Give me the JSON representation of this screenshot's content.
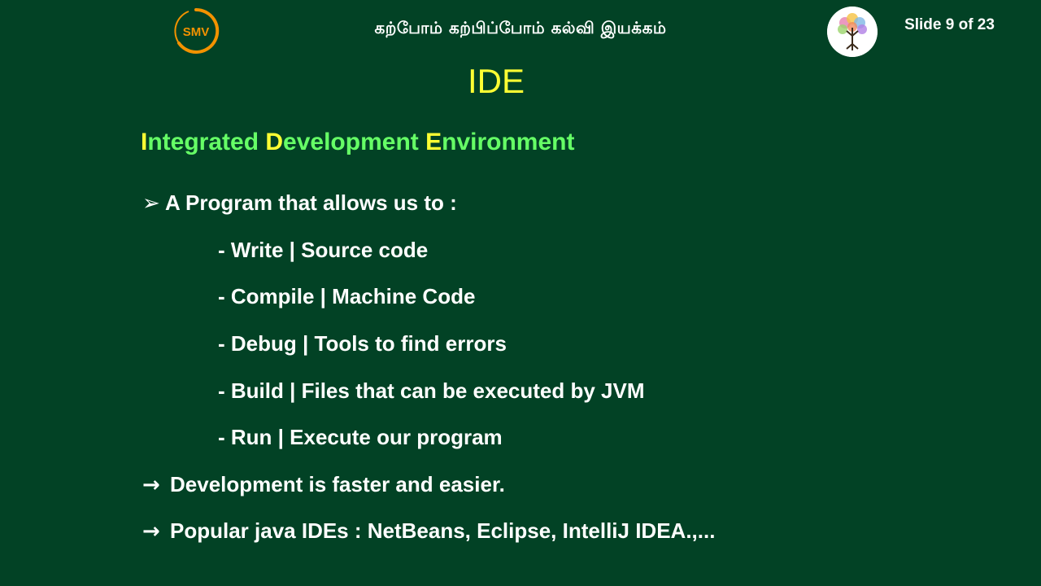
{
  "header": {
    "left_logo_text": "SMV",
    "tagline": "கற்போம் கற்பிப்போம் கல்வி இயக்கம்",
    "right_logo_icon": "tree-logo-icon",
    "slide_counter": "Slide 9 of 23"
  },
  "slide": {
    "title": "IDE",
    "subtitle": {
      "part1_initial": "I",
      "part1_rest": "ntegrated ",
      "part2_initial": "D",
      "part2_rest": "evelopment ",
      "part3_initial": "E",
      "part3_rest": "nvironment"
    },
    "intro_glyph": "➢",
    "intro": "A Program that allows us to :",
    "items": [
      "- Write | Source code",
      "- Compile | Machine Code",
      "- Debug | Tools to find errors",
      "- Build | Files that can be executed by JVM",
      "- Run | Execute our program"
    ],
    "arrow_glyph": "→",
    "notes": [
      "Development is faster and easier.",
      "Popular java IDEs : NetBeans, Eclipse, IntelliJ IDEA.,..."
    ]
  },
  "colors": {
    "background": "#024225",
    "title": "#ffff33",
    "subtitle": "#66ff66",
    "logo_orange": "#f39200"
  }
}
